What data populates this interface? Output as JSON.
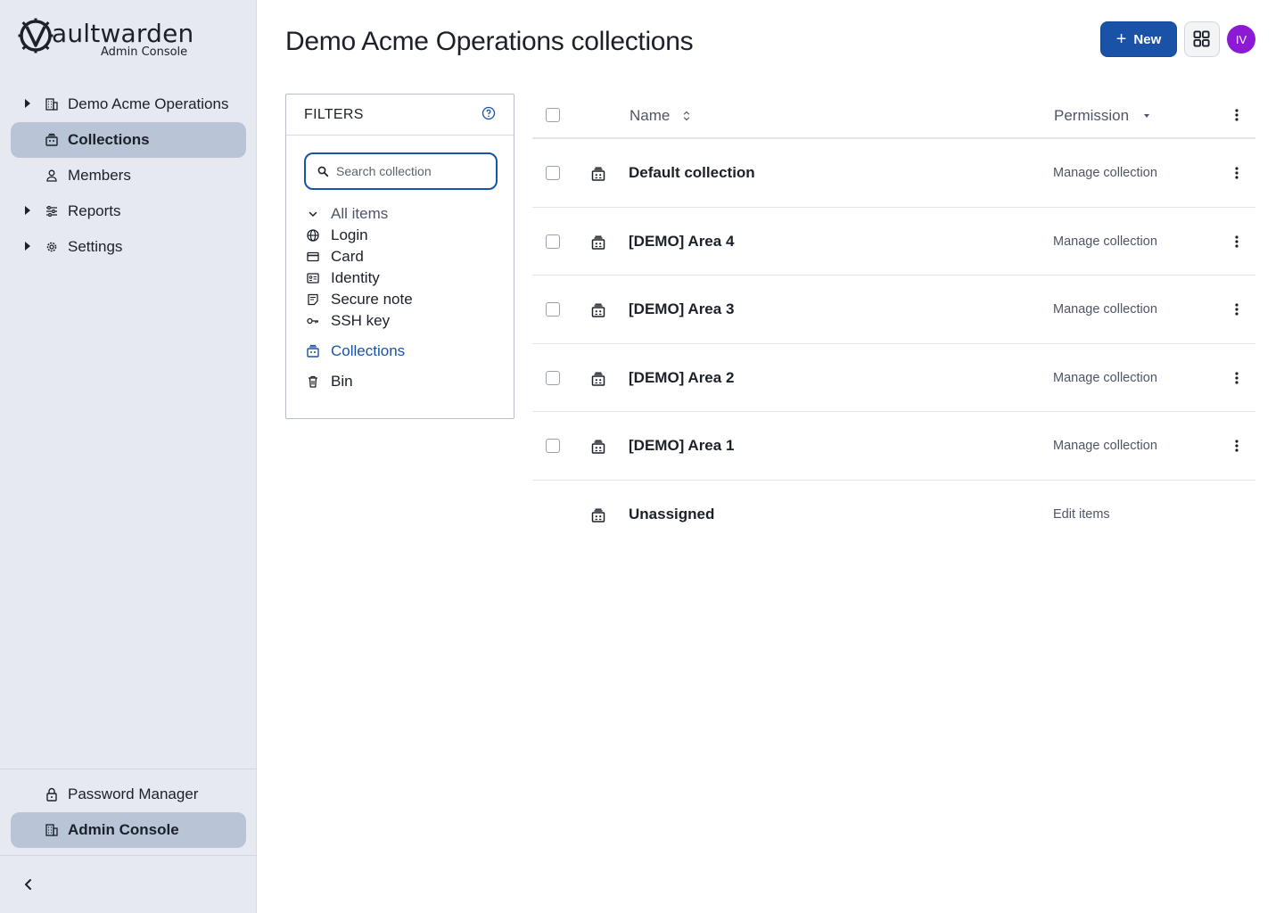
{
  "brand": {
    "wordmark": "ault warden",
    "wordmark_display": "aultwarden",
    "subtitle": "Admin Console"
  },
  "sidebar": {
    "items": [
      {
        "label": "Demo Acme Operations",
        "icon": "building-icon",
        "expandable": true,
        "active": false
      },
      {
        "label": "Collections",
        "icon": "collection-icon",
        "expandable": false,
        "active": true
      },
      {
        "label": "Members",
        "icon": "user-icon",
        "expandable": false,
        "active": false
      },
      {
        "label": "Reports",
        "icon": "sliders-icon",
        "expandable": true,
        "active": false
      },
      {
        "label": "Settings",
        "icon": "gear-icon",
        "expandable": true,
        "active": false
      }
    ],
    "bottom_items": [
      {
        "label": "Password Manager",
        "icon": "lock-icon",
        "active": false
      },
      {
        "label": "Admin Console",
        "icon": "building-icon",
        "active": true
      }
    ]
  },
  "header": {
    "title": "Demo Acme Operations collections",
    "new_button": "New",
    "avatar_initials": "IV",
    "avatar_color": "#8c1ad4"
  },
  "filters": {
    "title": "FILTERS",
    "search_placeholder": "Search collection",
    "all_items": "All items",
    "types": [
      {
        "label": "Login",
        "icon": "globe-icon"
      },
      {
        "label": "Card",
        "icon": "credit-card-icon"
      },
      {
        "label": "Identity",
        "icon": "id-card-icon"
      },
      {
        "label": "Secure note",
        "icon": "note-icon"
      },
      {
        "label": "SSH key",
        "icon": "key-icon"
      }
    ],
    "collections": "Collections",
    "bin": "Bin"
  },
  "table": {
    "col_name": "Name",
    "col_permission": "Permission",
    "rows": [
      {
        "name": "Default collection",
        "permission": "Manage collection",
        "selectable": true
      },
      {
        "name": "[DEMO] Area 4",
        "permission": "Manage collection",
        "selectable": true
      },
      {
        "name": "[DEMO] Area 3",
        "permission": "Manage collection",
        "selectable": true
      },
      {
        "name": "[DEMO] Area 2",
        "permission": "Manage collection",
        "selectable": true
      },
      {
        "name": "[DEMO] Area 1",
        "permission": "Manage collection",
        "selectable": true
      },
      {
        "name": "Unassigned",
        "permission": "Edit items",
        "selectable": false
      }
    ]
  },
  "colors": {
    "primary": "#1a52a7",
    "sidebar_bg": "#e6e9ef",
    "sidebar_active": "#b9c4d6"
  }
}
